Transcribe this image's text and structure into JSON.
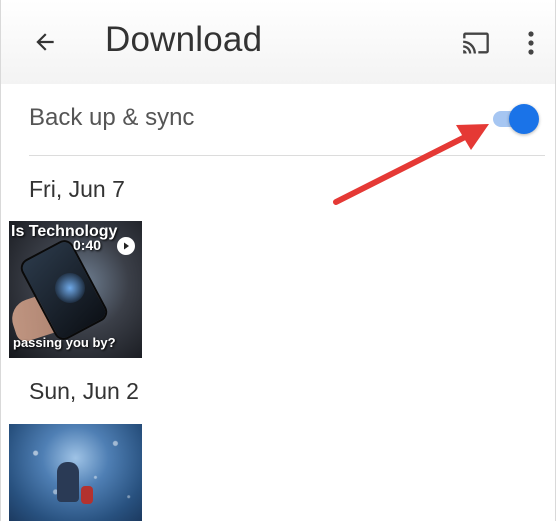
{
  "toolbar": {
    "title": "Download",
    "back_icon": "arrow-left-icon",
    "cast_icon": "cast-icon",
    "more_icon": "more-vert-icon"
  },
  "sync": {
    "label": "Back up & sync",
    "enabled": true,
    "accent_color": "#1a73e8"
  },
  "sections": [
    {
      "date": "Fri, Jun 7",
      "item": {
        "type": "video",
        "caption_top": "Is Technology",
        "duration": "0:40",
        "caption_bottom": "passing you by?"
      }
    },
    {
      "date": "Sun, Jun 2",
      "item": {
        "type": "photo"
      }
    }
  ],
  "annotation": {
    "arrow_color": "#e53935",
    "points_to": "sync-toggle"
  }
}
